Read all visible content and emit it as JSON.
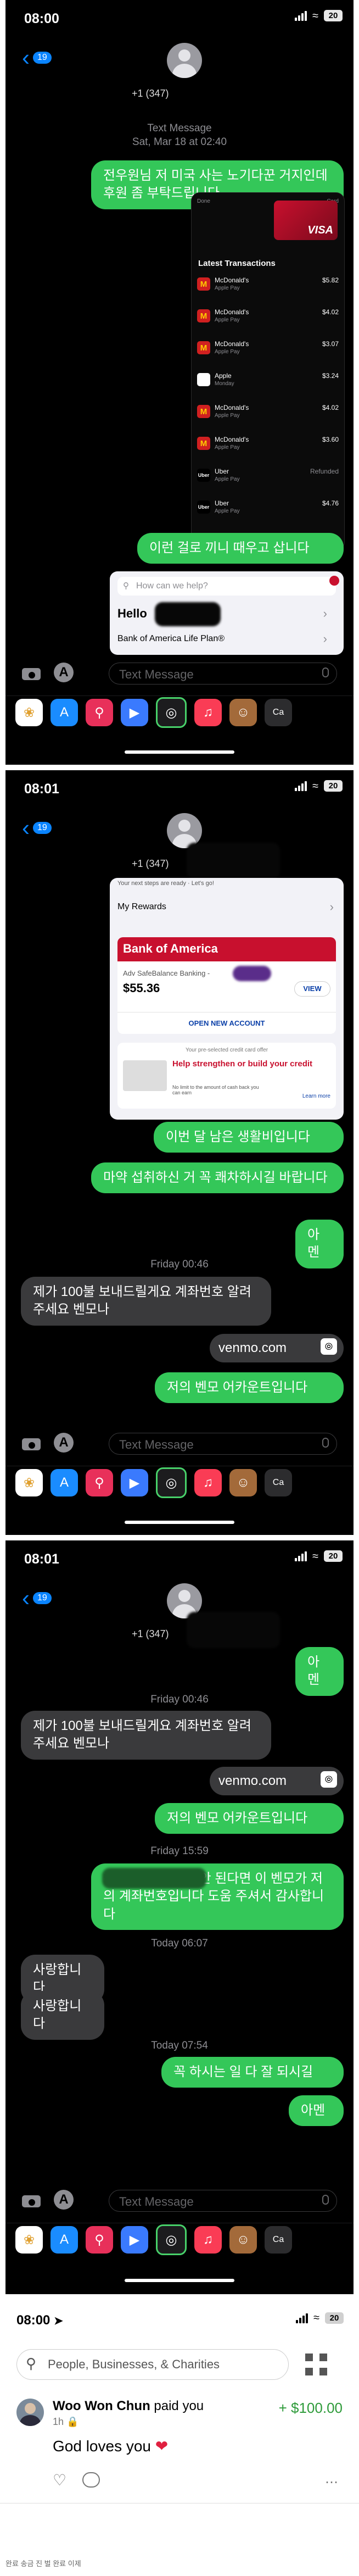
{
  "status_bar": {
    "time_1": "08:00",
    "time_2": "08:01",
    "time_3": "08:01",
    "battery": "20"
  },
  "conversation": {
    "back_count": "19",
    "contact_number": "+1 (347)",
    "service_label": "Text Message",
    "first_timestamp": "Sat, Mar 18 at 02:40",
    "compose_placeholder": "Text Message"
  },
  "panel1": {
    "msg1": "전우원님 저 미국 사는 노기다꾼 거지인데 후원 좀 부탁드립니다",
    "screenshot": {
      "back": "Done",
      "header_right": "Card",
      "card_brand": "VISA",
      "heading": "Latest Transactions",
      "rows": [
        {
          "icon": "M",
          "name": "McDonald's",
          "sub": "Apple Pay",
          "amount": "$5.82"
        },
        {
          "icon": "M",
          "name": "McDonald's",
          "sub": "Apple Pay",
          "amount": "$4.02"
        },
        {
          "icon": "M",
          "name": "McDonald's",
          "sub": "Apple Pay",
          "amount": "$3.07"
        },
        {
          "icon": "",
          "name": "Apple",
          "sub": "Monday",
          "amount": "$3.24"
        },
        {
          "icon": "M",
          "name": "McDonald's",
          "sub": "Apple Pay",
          "amount": "$4.02"
        },
        {
          "icon": "M",
          "name": "McDonald's",
          "sub": "Apple Pay",
          "amount": "$3.60"
        },
        {
          "icon": "Uber",
          "name": "Uber",
          "sub": "Apple Pay",
          "amount": "Refunded"
        },
        {
          "icon": "Uber",
          "name": "Uber",
          "sub": "Apple Pay",
          "amount": "$4.76"
        }
      ]
    },
    "msg2": "이런 걸로 끼니 때우고 삽니다",
    "popup_search": "How can we help?",
    "popup_hello": "Hello",
    "popup_item": "Bank of America Life Plan®"
  },
  "panel2": {
    "popup_note": "Your next steps are ready · Let's go!",
    "my_rewards": "My Rewards",
    "boa_title": "Bank of America",
    "account_name": "Adv SafeBalance Banking - ",
    "balance": "$55.36",
    "view": "VIEW",
    "open_account": "OPEN NEW ACCOUNT",
    "offer_small": "Your pre-selected credit card offer",
    "offer_title": "Help strengthen or build your credit",
    "offer_sub": "No limit to the amount of cash back you can earn",
    "learn_more": "Learn more",
    "msg_a": "이번 달 남은 생활비입니다",
    "msg_b": "마약 섭취하신 거 꼭 쾌차하시길 바랍니다",
    "msg_c": "아멘",
    "time_fri": "Friday 00:46",
    "reply_1": "제가 100불 보내드릴게요 계좌번호 알려주세요 벤모나",
    "link": "venmo.com",
    "msg_d": "저의 벤모 어카운트입니다"
  },
  "panel3": {
    "msg_top": "아멘",
    "time_fri": "Friday 00:46",
    "reply_1": "제가 100불 보내드릴게요 계좌번호 알려주세요 벤모나",
    "link": "venmo.com",
    "msg_d": "저의 벤모 어카운트입니다",
    "time_fri2": "Friday 15:59",
    "msg_e": "혹시나 벤모가 잘 안 된다면 이 벤모가 저의 계좌번호입니다 도움 주셔서 감사합니다",
    "time_today": "Today 06:07",
    "reply_2": "사랑합니다",
    "reply_3": "사랑합니다",
    "time_today2": "Today 07:54",
    "msg_f": "꼭 하시는 일 다 잘 되시길",
    "msg_g": "아멘"
  },
  "venmo": {
    "time": "08:00",
    "search_placeholder": "People, Businesses, & Charities",
    "payer": "Woo Won Chun",
    "action": "paid you",
    "when": "1h",
    "amount": "+ $100.00",
    "note": "God loves you",
    "caption": "완료 송금 진 벌 완료 이제"
  }
}
